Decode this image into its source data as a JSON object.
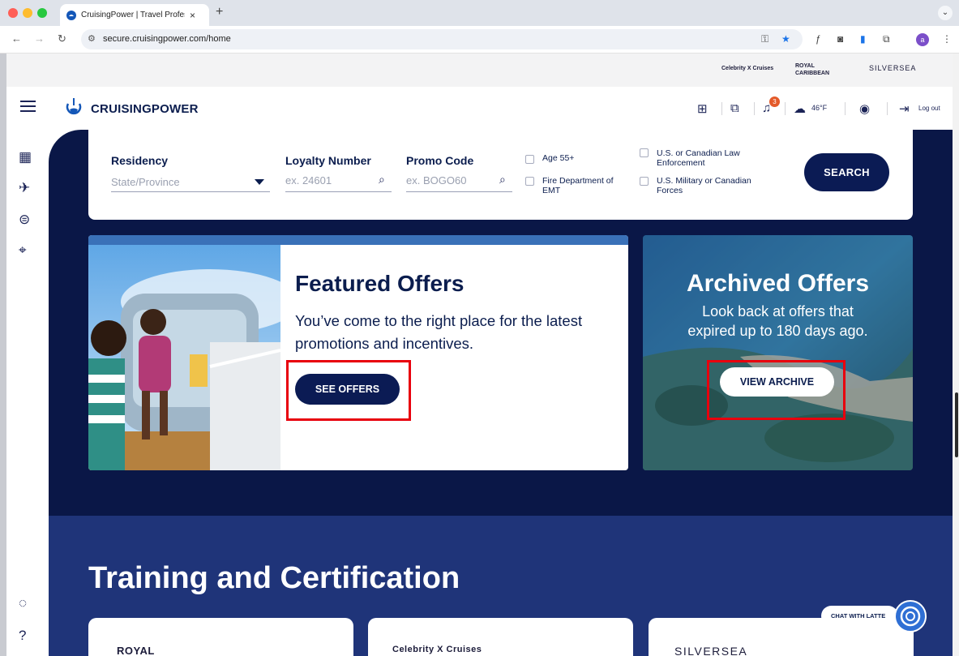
{
  "browser": {
    "tab_title": "CruisingPower | Travel Profes",
    "tab_close": "×",
    "new_tab": "+",
    "url": "secure.cruisingpower.com/home",
    "profile_initial": "a"
  },
  "brand_bar": {
    "celebrity": "Celebrity X Cruises",
    "royal": "ROYAL CARIBBEAN",
    "silversea": "SILVERSEA"
  },
  "header": {
    "logo": "CRUISINGPOWER",
    "notification_count": "3",
    "temperature": "46°F",
    "logout": "Log out"
  },
  "search": {
    "residency_label": "Residency",
    "residency_placeholder": "State/Province",
    "loyalty_label": "Loyalty Number",
    "loyalty_placeholder": "ex. 24601",
    "promo_label": "Promo Code",
    "promo_placeholder": "ex. BOGO60",
    "checkboxes": {
      "age": "Age 55+",
      "fire": "Fire Department of EMT",
      "law": "U.S. or Canadian Law Enforcement",
      "military": "U.S. Military or Canadian Forces"
    },
    "button": "SEARCH"
  },
  "featured": {
    "title": "Featured Offers",
    "description": "You’ve come to the right place for the latest promotions and incentives.",
    "button": "SEE OFFERS"
  },
  "archived": {
    "title": "Archived Offers",
    "description": "Look back at offers that expired up to 180 days ago.",
    "button": "VIEW ARCHIVE"
  },
  "training": {
    "title": "Training and Certification",
    "cards": [
      "ROYAL",
      "Celebrity X Cruises",
      "SILVERSEA"
    ]
  },
  "chat": {
    "label": "CHAT WITH LATTE"
  },
  "colors": {
    "navy": "#0b1b54",
    "accent_blue": "#3a71b8",
    "highlight_red": "#e8000d",
    "training_bg": "#1f3479"
  }
}
